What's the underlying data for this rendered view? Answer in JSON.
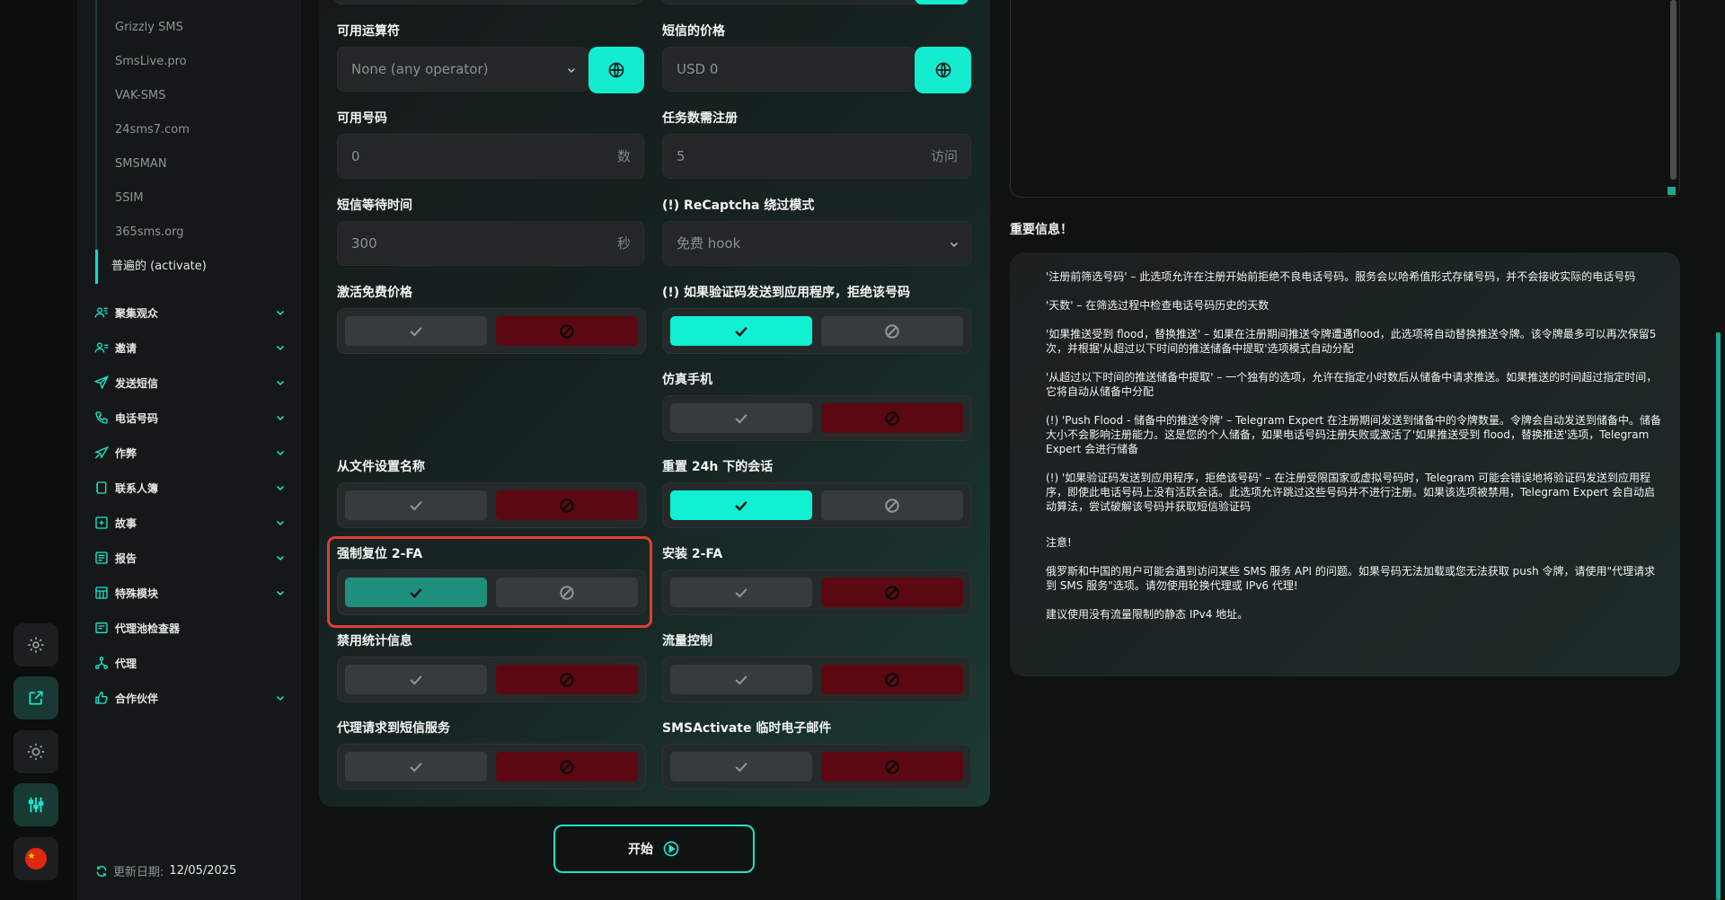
{
  "sidebar": {
    "sub_items": [
      "Grizzly SMS",
      "SmsLive.pro",
      "VAK-SMS",
      "24sms7.com",
      "SMSMAN",
      "5SIM",
      "365sms.org",
      "普遍的 (activate)"
    ],
    "nav": [
      {
        "label": "聚集观众",
        "icon": "users-icon",
        "chev": true
      },
      {
        "label": "邀请",
        "icon": "user-plus-icon",
        "chev": true
      },
      {
        "label": "发送短信",
        "icon": "send-icon",
        "chev": true
      },
      {
        "label": "电话号码",
        "icon": "phone-icon",
        "chev": true
      },
      {
        "label": "作弊",
        "icon": "paper-plane-icon",
        "chev": true
      },
      {
        "label": "联系人簿",
        "icon": "contacts-icon",
        "chev": true
      },
      {
        "label": "故事",
        "icon": "plus-square-icon",
        "chev": true
      },
      {
        "label": "报告",
        "icon": "report-icon",
        "chev": true
      },
      {
        "label": "特殊模块",
        "icon": "module-icon",
        "chev": true
      },
      {
        "label": "代理池检查器",
        "icon": "proxy-check-icon",
        "chev": false
      },
      {
        "label": "代理",
        "icon": "network-icon",
        "chev": false
      },
      {
        "label": "合作伙伴",
        "icon": "thumb-up-icon",
        "chev": true
      }
    ],
    "updated_label": "更新日期:",
    "updated_date": "12/05/2025"
  },
  "form": {
    "operator_label": "可用运算符",
    "operator_value": "None (any operator)",
    "price_label": "短信的价格",
    "price_value": "USD  0",
    "numbers_label": "可用号码",
    "numbers_value": "0",
    "numbers_suffix": "数",
    "tasks_label": "任务数需注册",
    "tasks_value": "5",
    "tasks_suffix": "访问",
    "wait_label": "短信等待时间",
    "wait_value": "300",
    "wait_suffix": "秒",
    "recaptcha_label": "(!) ReCaptcha 绕过模式",
    "recaptcha_value": "免费 hook",
    "toggles": {
      "free_price": "激活免费价格",
      "reject_app": "(!) 如果验证码发送到应用程序，拒绝该号码",
      "emulator": "仿真手机",
      "names_from_file": "从文件设置名称",
      "reset_24h": "重置 24h 下的会话",
      "force_2fa": "强制复位 2-FA",
      "install_2fa": "安装 2-FA",
      "disable_stats": "禁用统计信息",
      "traffic": "流量控制",
      "proxy_sms": "代理请求到短信服务",
      "sms_email": "SMSActivate 临时电子邮件"
    },
    "start_label": "开始"
  },
  "info": {
    "title": "重要信息！",
    "paragraphs": [
      "'注册前筛选号码' – 此选项允许在注册开始前拒绝不良电话号码。服务会以哈希值形式存储号码，并不会接收实际的电话号码",
      "'天数' – 在筛选过程中检查电话号码历史的天数",
      "'如果推送受到 flood，替换推送' – 如果在注册期间推送令牌遭遇flood，此选项将自动替换推送令牌。该令牌最多可以再次保留5次，并根据'从超过以下时间的推送储备中提取'选项模式自动分配",
      "'从超过以下时间的推送储备中提取' – 一个独有的选项，允许在指定小时数后从储备中请求推送。如果推送的时间超过指定时间，它将自动从储备中分配",
      "(!) 'Push Flood - 储备中的推送令牌' – Telegram Expert 在注册期间发送到储备中的令牌数量。令牌会自动发送到储备中。储备大小不会影响注册能力。这是您的个人储备，如果电话号码注册失败或激活了'如果推送受到 flood，替换推送'选项，Telegram Expert 会进行储备",
      "(!) '如果验证码发送到应用程序，拒绝该号码' – 在注册受限国家或虚拟号码时，Telegram 可能会错误地将验证码发送到应用程序，即使此电话号码上没有活跃会话。此选项允许跳过这些号码并不进行注册。如果该选项被禁用，Telegram Expert 会自动启动算法，尝试破解该号码并获取短信验证码",
      "注意!",
      "俄罗斯和中国的用户可能会遇到访问某些 SMS 服务 API 的问题。如果号码无法加载或您无法获取 push 令牌，请使用\"代理请求到 SMS 服务\"选项。请勿使用轮换代理或 IPv6 代理!",
      "建议使用没有流量限制的静态 IPv4 地址。"
    ]
  },
  "colors": {
    "accent": "#14ecd0",
    "danger": "#5c0812",
    "highlight": "#e03e33"
  }
}
